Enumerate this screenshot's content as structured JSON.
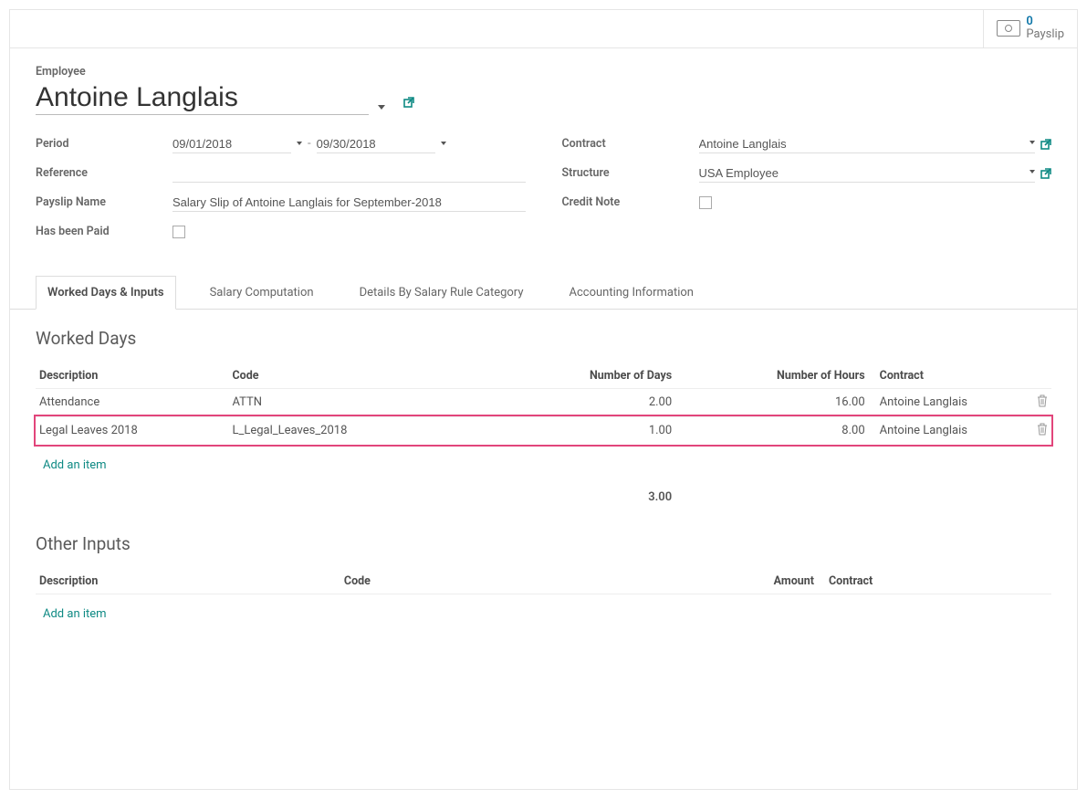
{
  "stat": {
    "count": "0",
    "label": "Payslip"
  },
  "labels": {
    "employee": "Employee",
    "period": "Period",
    "reference": "Reference",
    "payslip_name": "Payslip Name",
    "has_been_paid": "Has been Paid",
    "contract": "Contract",
    "structure": "Structure",
    "credit_note": "Credit Note"
  },
  "employee_name": "Antoine Langlais",
  "period_from": "09/01/2018",
  "period_sep": "-",
  "period_to": "09/30/2018",
  "reference": "",
  "payslip_name": "Salary Slip of Antoine Langlais for September-2018",
  "contract": "Antoine Langlais",
  "structure": "USA Employee",
  "tabs": {
    "t0": "Worked Days & Inputs",
    "t1": "Salary Computation",
    "t2": "Details By Salary Rule Category",
    "t3": "Accounting Information"
  },
  "worked_days": {
    "title": "Worked Days",
    "headers": {
      "desc": "Description",
      "code": "Code",
      "days": "Number of Days",
      "hours": "Number of Hours",
      "contract": "Contract"
    },
    "rows": [
      {
        "desc": "Attendance",
        "code": "ATTN",
        "days": "2.00",
        "hours": "16.00",
        "contract": "Antoine Langlais"
      },
      {
        "desc": "Legal Leaves 2018",
        "code": "L_Legal_Leaves_2018",
        "days": "1.00",
        "hours": "8.00",
        "contract": "Antoine Langlais"
      }
    ],
    "add": "Add an item",
    "total_days": "3.00"
  },
  "other_inputs": {
    "title": "Other Inputs",
    "headers": {
      "desc": "Description",
      "code": "Code",
      "amount": "Amount",
      "contract": "Contract"
    },
    "add": "Add an item"
  }
}
